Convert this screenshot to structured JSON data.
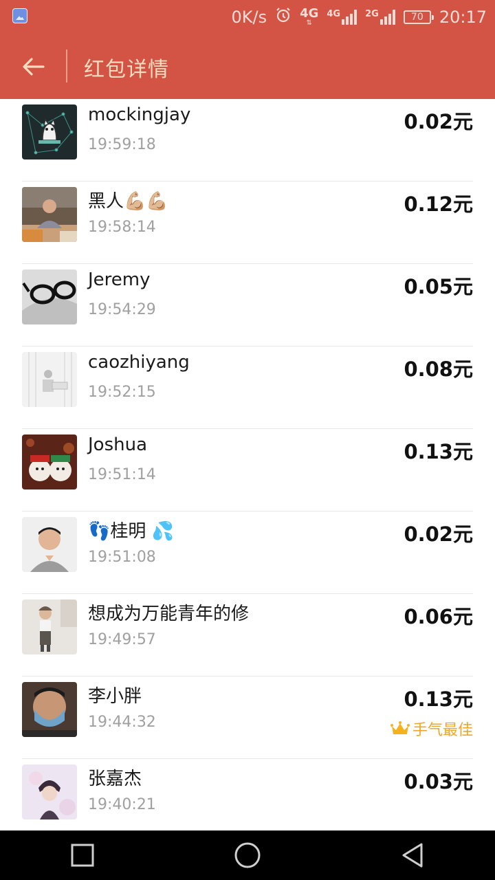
{
  "status_bar": {
    "speed": "0K/s",
    "net1": "4G",
    "net2": "4G",
    "net3": "2G",
    "battery": "70",
    "time": "20:17"
  },
  "app_bar": {
    "title": "红包详情"
  },
  "entries": [
    {
      "name": "mockingjay",
      "time": "19:59:18",
      "amount": "0.02元"
    },
    {
      "name": "黑人💪🏼💪🏼",
      "time": "19:58:14",
      "amount": "0.12元"
    },
    {
      "name": "Jeremy",
      "time": "19:54:29",
      "amount": "0.05元"
    },
    {
      "name": "caozhiyang",
      "time": "19:52:15",
      "amount": "0.08元"
    },
    {
      "name": "Joshua",
      "time": "19:51:14",
      "amount": "0.13元"
    },
    {
      "name": "👣桂明 💦",
      "time": "19:51:08",
      "amount": "0.02元"
    },
    {
      "name": "想成为万能青年的修",
      "time": "19:49:57",
      "amount": "0.06元"
    },
    {
      "name": "李小胖",
      "time": "19:44:32",
      "amount": "0.13元",
      "badge": "手气最佳"
    },
    {
      "name": "张嘉杰",
      "time": "19:40:21",
      "amount": "0.03元"
    }
  ],
  "colors": {
    "header": "#d35444",
    "header_text": "#f7dcc0",
    "best_badge": "#f0a624"
  }
}
